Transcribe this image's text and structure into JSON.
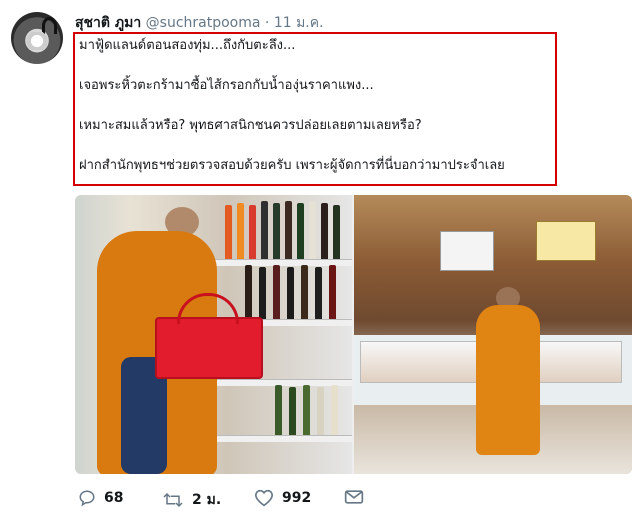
{
  "author": {
    "name": "สุชาติ ภูมา",
    "handle": "@suchratpooma",
    "separator": "·",
    "date": "11 ม.ค."
  },
  "tweet": {
    "lines": [
      "มาฟู้ดแลนด์ตอนสองทุ่ม...ถึงกับตะลึง...",
      "เจอพระหิ้วตะกร้ามาซื้อไส้กรอกกับน้ำองุ่นราคาแพง...",
      "เหมาะสมแล้วหรือ? พุทธศาสนิกชนควรปล่อยเลยตามเลยหรือ?",
      "ฝากสำนักพุทธฯช่วยตรวจสอบด้วยครับ เพราะผู้จัดการที่นี่บอกว่ามาประจำเลย"
    ],
    "highlight_color": "#d40000"
  },
  "actions": {
    "reply": {
      "icon": "reply-icon",
      "count": "68"
    },
    "retweet": {
      "icon": "retweet-icon",
      "count": "2 ม."
    },
    "like": {
      "icon": "heart-icon",
      "count": "992"
    },
    "message": {
      "icon": "envelope-icon"
    }
  }
}
